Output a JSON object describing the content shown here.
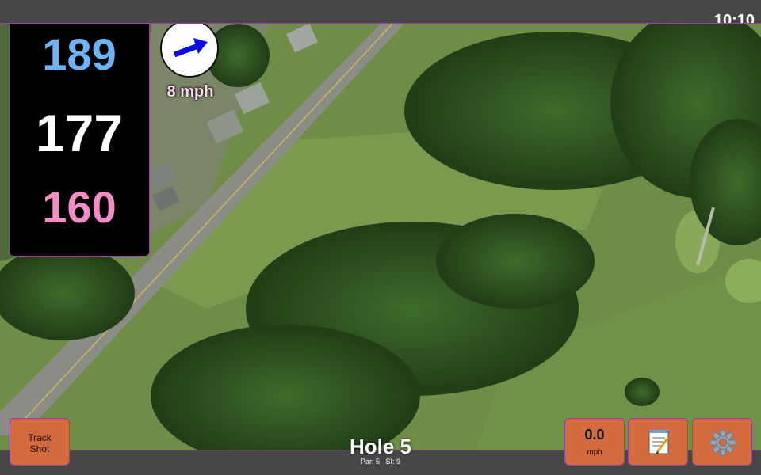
{
  "clock": "10:10",
  "distances": {
    "back": "189",
    "center": "177",
    "front": "160"
  },
  "wind": {
    "speed": "8 mph",
    "direction_icon": "arrow-right-icon"
  },
  "buttons": {
    "track_shot": "Track Shot",
    "speed_value": "0.0",
    "speed_unit": "mph",
    "notes_icon": "notepad-icon",
    "settings_icon": "gear-icon"
  },
  "hole": {
    "title": "Hole 5",
    "par": "Par: 5",
    "si": "SI: 9"
  },
  "colors": {
    "back": "#6cb4f5",
    "center": "#ffffff",
    "front": "#f58cc8",
    "button": "#d36b3f",
    "accent_border": "#9b3fa0"
  }
}
